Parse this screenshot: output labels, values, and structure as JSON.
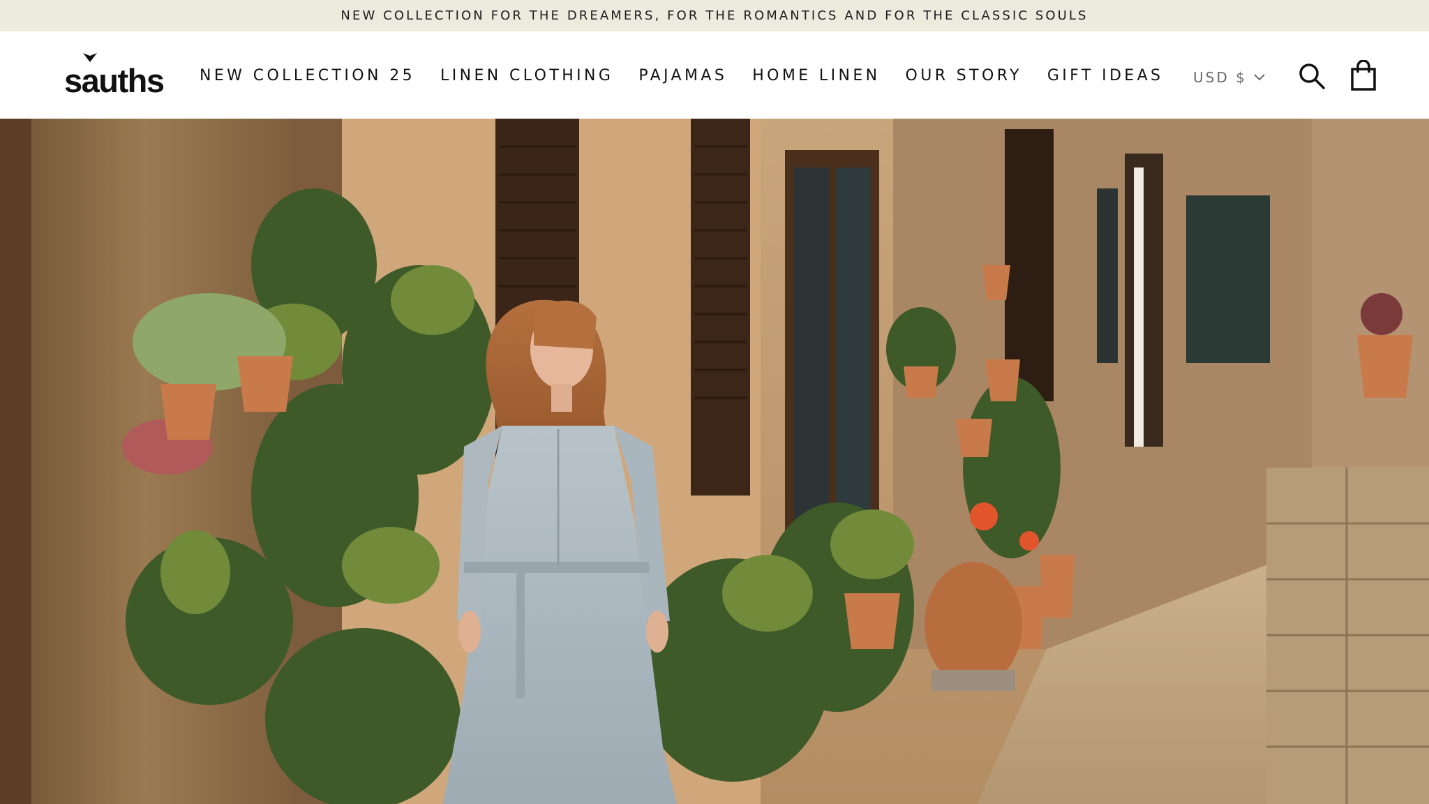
{
  "announcement": {
    "text": "NEW COLLECTION FOR THE DREAMERS, FOR THE ROMANTICS AND FOR THE CLASSIC SOULS"
  },
  "header": {
    "logo_text_start": "s",
    "logo_text_accent": "a",
    "logo_text_end": "uths",
    "nav": [
      {
        "label": "NEW COLLECTION 25"
      },
      {
        "label": "LINEN CLOTHING"
      },
      {
        "label": "PAJAMAS"
      },
      {
        "label": "HOME LINEN"
      },
      {
        "label": "OUR STORY"
      },
      {
        "label": "GIFT IDEAS"
      }
    ],
    "currency": "USD $",
    "icons": {
      "currency_dropdown": "chevron-down-icon",
      "search": "search-icon",
      "cart": "shopping-bag-icon"
    }
  },
  "colors": {
    "announcement_bg": "#ecebde",
    "header_bg": "#ffffff",
    "text": "#1a1a1a",
    "muted": "#6b6b6b"
  }
}
